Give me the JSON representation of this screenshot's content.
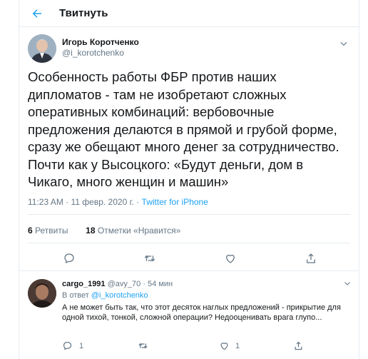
{
  "header": {
    "title": "Твитнуть"
  },
  "tweet": {
    "author_name": "Игорь Коротченко",
    "author_handle": "@i_korotchenko",
    "text": "Особенность работы ФБР против наших дипломатов - там не изобретают сложных оперативных комбинаций: вербовочные предложения делаются в прямой и грубой форме, сразу же обещают много денег за сотрудничество. Почти как у Высоцкого: «Будут деньги, дом в Чикаго, много женщин и машин»",
    "time": "11:23 AM",
    "date": "11 февр. 2020 г.",
    "source": "Twitter for iPhone",
    "retweets_count": "6",
    "retweets_label": "Ретвиты",
    "likes_count": "18",
    "likes_label": "Отметки «Нравится»"
  },
  "reply": {
    "author_name": "cargo_1991",
    "author_handle": "@avy_70",
    "time": "54 мин",
    "reply_to_prefix": "В ответ",
    "reply_to_handle": "@i_korotchenko",
    "text": "А не может быть так, что этот десяток наглых предложений - прикрытие для одной тихой, тонкой, сложной операции? Недооценивать врага глупо...",
    "reply_count": "1",
    "like_count": "1"
  },
  "icons": {
    "back": "arrow-left-icon",
    "caret": "chevron-down-icon",
    "reply": "comment-icon",
    "retweet": "retweet-icon",
    "like": "heart-icon",
    "share": "share-icon"
  },
  "colors": {
    "accent": "#1da1f2",
    "secondary_text": "#657786",
    "border": "#e6ecf0"
  }
}
